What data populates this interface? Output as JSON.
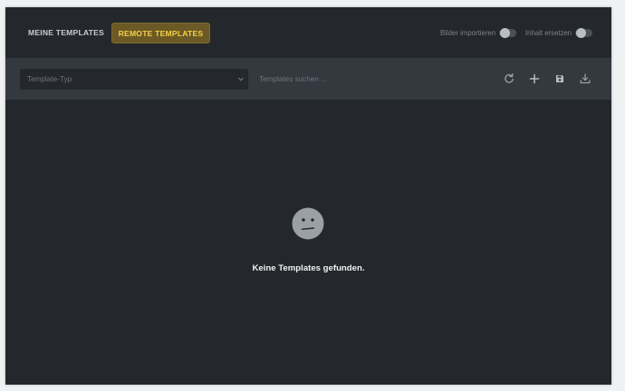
{
  "tabs": {
    "my_templates": "Meine Templates",
    "remote_templates": "Remote Templates"
  },
  "toggles": {
    "import_images_label": "Bilder importieren",
    "replace_content_label": "Inhalt ersetzen"
  },
  "toolbar": {
    "template_type_placeholder": "Template-Typ",
    "search_placeholder": "Templates suchen ..."
  },
  "icons": {
    "refresh": "refresh-icon",
    "add": "plus-icon",
    "save": "save-icon",
    "download": "download-icon",
    "empty_state": "neutral-face-icon"
  },
  "empty_state": {
    "message": "Keine Templates gefunden."
  },
  "colors": {
    "background": "#24282c",
    "toolbar": "#33393f",
    "accent_text": "#f7d148",
    "accent_bg": "#6b5a25"
  }
}
